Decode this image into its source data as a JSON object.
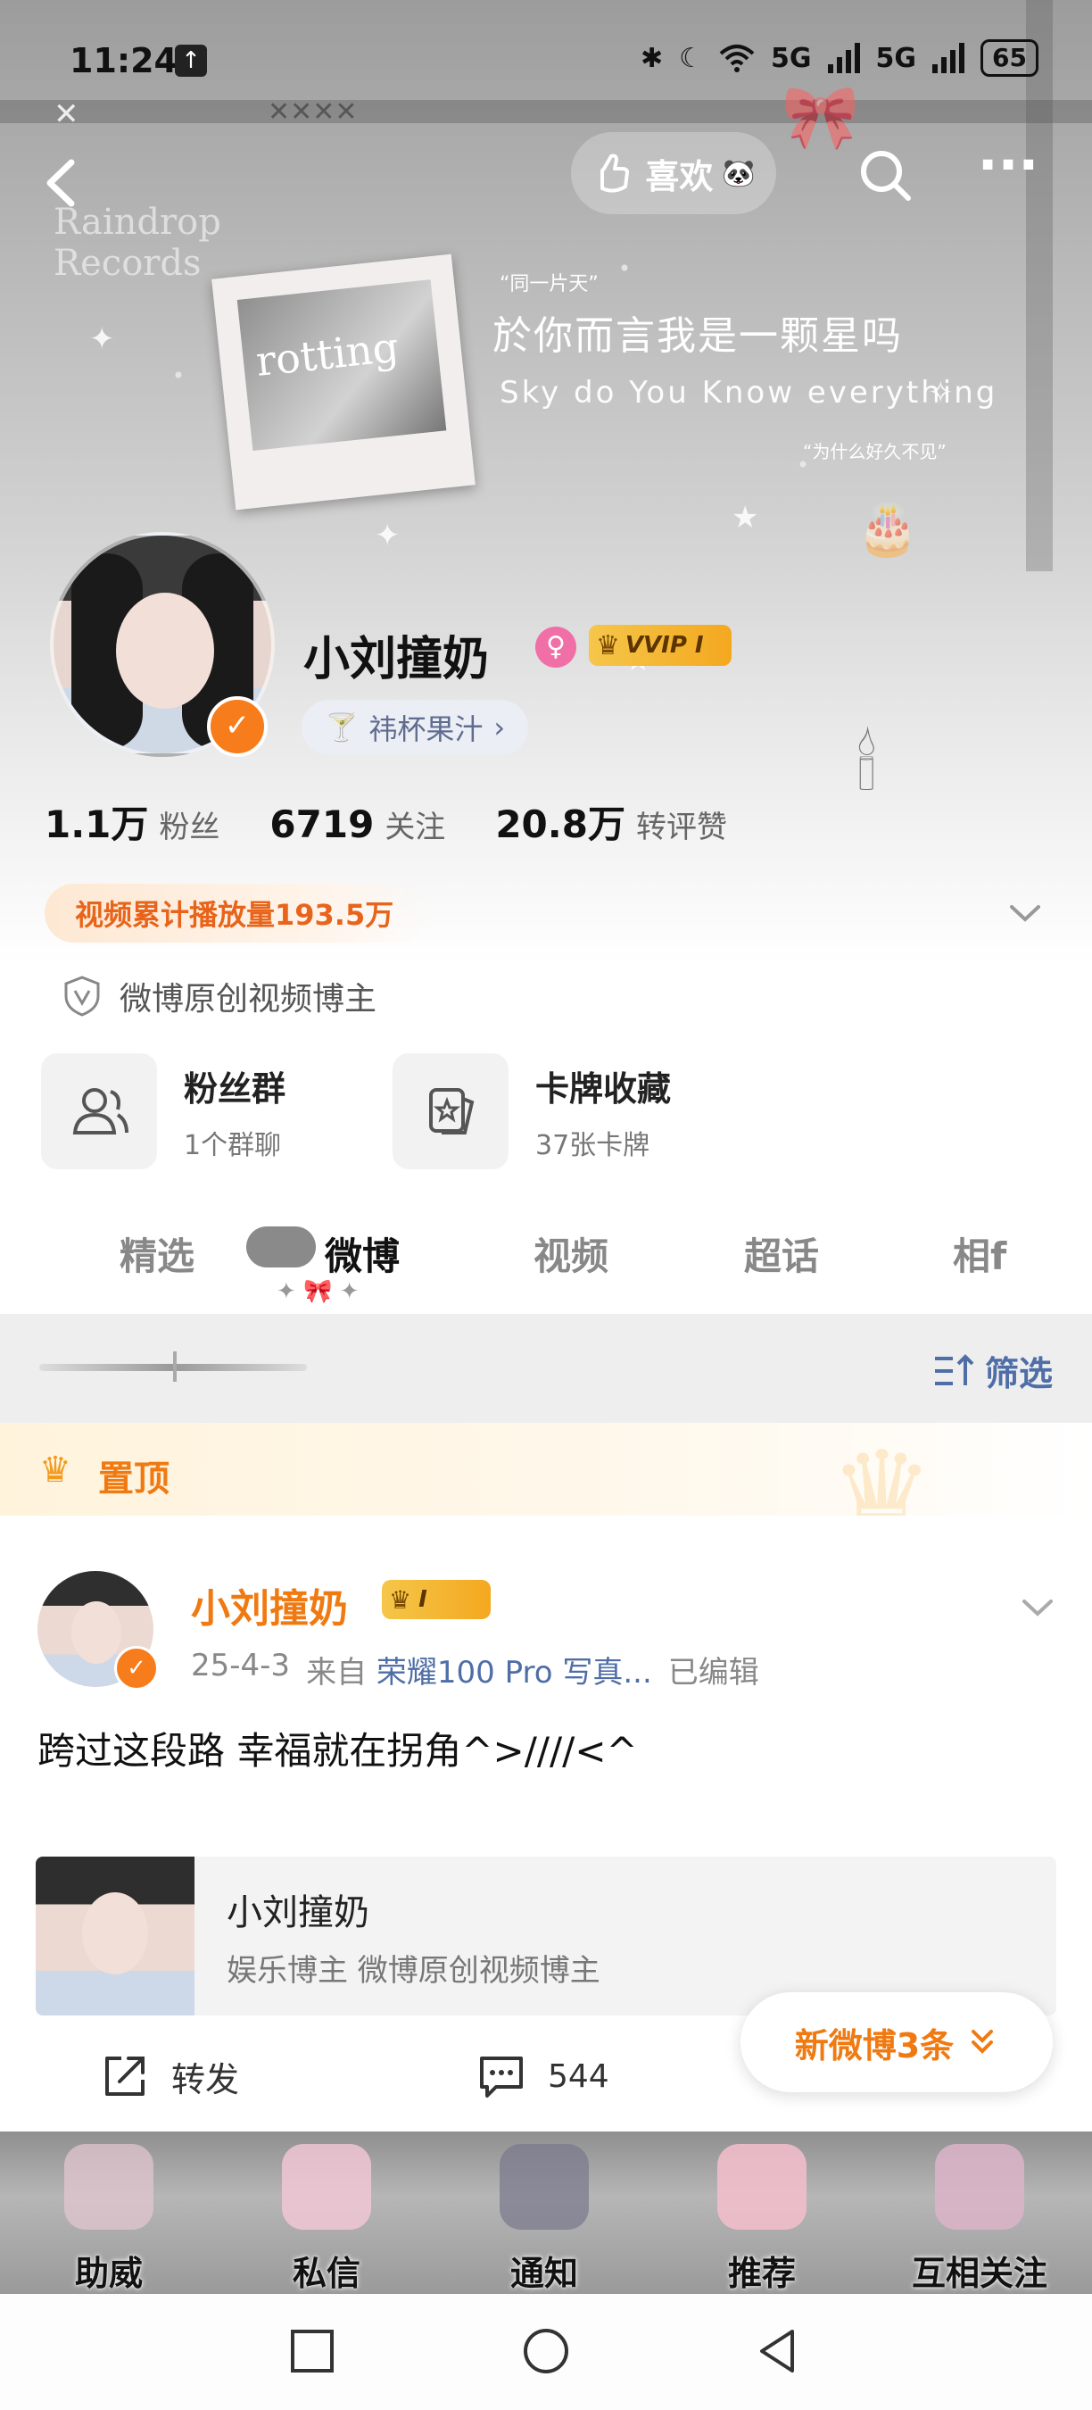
{
  "status_bar": {
    "time": "11:24",
    "signal_1": "5G",
    "signal_2": "5G",
    "battery": "65"
  },
  "nav": {
    "like_label": "喜欢"
  },
  "banner": {
    "brand_text_1": "Raindrop",
    "brand_text_2": "Records",
    "photo_caption": "rotting",
    "quote_small": "“同一片天”",
    "quote_main": "於你而言我是一颗星吗",
    "quote_en": "Sky do You Know everything",
    "quote_bottom": "“为什么好久不见”"
  },
  "profile": {
    "name": "小刘撞奶",
    "vip_label": "VVIP I",
    "fan_club": "祎杯果汁",
    "stats": [
      {
        "num": "1.1万",
        "label": "粉丝"
      },
      {
        "num": "6719",
        "label": "关注"
      },
      {
        "num": "20.8万",
        "label": "转评赞"
      }
    ],
    "play_count": "视频累计播放量193.5万",
    "creator_label": "微博原创视频博主"
  },
  "cards": [
    {
      "title": "粉丝群",
      "sub": "1个群聊"
    },
    {
      "title": "卡牌收藏",
      "sub": "37张卡牌"
    }
  ],
  "tabs": [
    "精选",
    "微博",
    "视频",
    "超话",
    "相f"
  ],
  "filter": {
    "label": "筛选"
  },
  "pinned": {
    "label": "置顶"
  },
  "post": {
    "author": "小刘撞奶",
    "vip_level": "I",
    "date": "25-4-3",
    "from_label": "来自",
    "source": "荣耀100 Pro 写真...",
    "edited": "已编辑",
    "text": "跨过这段路 幸福就在拐角^>////<^",
    "shared_card": {
      "name": "小刘撞奶",
      "desc": "娱乐博主 微博原创视频博主"
    },
    "repost_label": "转发",
    "comment_count": "544"
  },
  "new_posts": "新微博3条",
  "bottom_tabs": [
    "助威",
    "私信",
    "通知",
    "推荐",
    "互相关注"
  ],
  "colors": {
    "accent_orange": "#f07a12",
    "link_blue": "#4f6ea7",
    "vip_gold": "#f4a81f"
  }
}
